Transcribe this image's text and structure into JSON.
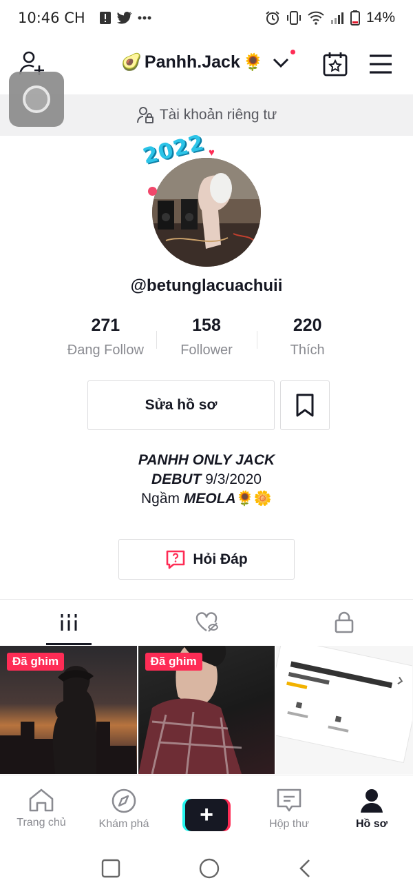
{
  "status_bar": {
    "time": "10:46 CH",
    "battery": "14%"
  },
  "header": {
    "username": "Panhh.Jack",
    "username_prefix_emoji": "🥑",
    "username_suffix_emoji": "🌻"
  },
  "private_notice": "Tài khoản riêng tư",
  "avatar": {
    "year_badge": "2022"
  },
  "handle": "@betunglacuachuii",
  "stats": [
    {
      "value": "271",
      "label": "Đang Follow"
    },
    {
      "value": "158",
      "label": "Follower"
    },
    {
      "value": "220",
      "label": "Thích"
    }
  ],
  "buttons": {
    "edit_profile": "Sửa hồ sơ",
    "qa": "Hỏi Đáp"
  },
  "bio": {
    "line1": "PANHH ONLY JACK",
    "line2_bold": "DEBUT",
    "line2_rest": " 9/3/2020",
    "line3_prefix": "Ngầm ",
    "line3_bold": "MEOLA",
    "line3_emoji": "🌻🌼"
  },
  "videos": [
    {
      "pinned_label": "Đã ghim"
    },
    {
      "pinned_label": "Đã ghim"
    },
    {
      "pinned_label": ""
    }
  ],
  "bottom_nav": [
    {
      "label": "Trang chủ",
      "icon": "home-icon"
    },
    {
      "label": "Khám phá",
      "icon": "compass-icon"
    },
    {
      "label": "",
      "icon": "plus-icon"
    },
    {
      "label": "Hộp thư",
      "icon": "inbox-icon"
    },
    {
      "label": "Hồ sơ",
      "icon": "profile-icon",
      "active": true
    }
  ],
  "colors": {
    "accent": "#fe2c55",
    "cyan": "#25f4ee",
    "text": "#161823",
    "muted": "#8a8b91"
  }
}
